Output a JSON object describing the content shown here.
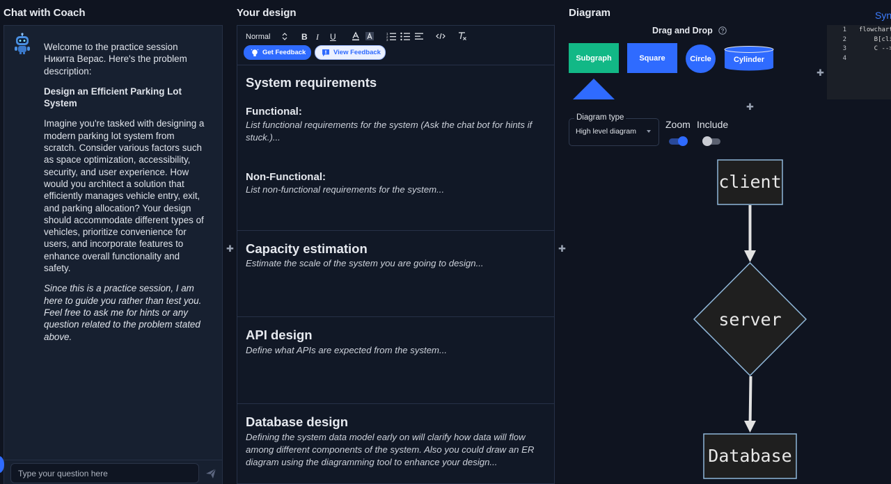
{
  "sections": {
    "chat_title": "Chat with Coach",
    "design_title": "Your design",
    "diagram_title": "Diagram"
  },
  "chat": {
    "intro": "Welcome to the practice session Никита Верас. Here's the problem description:",
    "problem_title": "Design an Efficient Parking Lot System",
    "problem_body": "Imagine you're tasked with designing a modern parking lot system from scratch. Consider various factors such as space optimization, accessibility, security, and user experience. How would you architect a solution that efficiently manages vehicle entry, exit, and parking allocation? Your design should accommodate different types of vehicles, prioritize convenience for users, and incorporate features to enhance overall functionality and safety.",
    "note": "Since this is a practice session, I am here to guide you rather than test you. Feel free to ask me for hints or any question related to the problem stated above.",
    "input_placeholder": "Type your question here"
  },
  "toolbar": {
    "format_value": "Normal",
    "get_feedback": "Get Feedback",
    "view_feedback": "View Feedback"
  },
  "design": {
    "system_req": {
      "heading": "System requirements",
      "functional_label": "Functional:",
      "functional_text": "List functional requirements for the system (Ask the chat bot for hints if stuck.)...",
      "nonfunctional_label": "Non-Functional:",
      "nonfunctional_text": "List non-functional requirements for the system..."
    },
    "capacity": {
      "heading": "Capacity estimation",
      "text": "Estimate the scale of the system you are going to design..."
    },
    "api": {
      "heading": "API design",
      "text": "Define what APIs are expected from the system..."
    },
    "database": {
      "heading": "Database design",
      "text": "Defining the system data model early on will clarify how data will flow among different components of the system. Also you could draw an ER diagram using the diagramming tool to enhance your design..."
    }
  },
  "diagram": {
    "palette_title": "Drag and Drop",
    "shapes": {
      "subgraph": "Subgraph",
      "square": "Square",
      "circle": "Circle",
      "cylinder": "Cylinder"
    },
    "type_label": "Diagram type",
    "type_value": "High level diagram",
    "zoom_label": "Zoom",
    "zoom_on": true,
    "include_label": "Include",
    "include_on": false,
    "nodes": {
      "client": "client",
      "server": "server",
      "database": "Database"
    }
  },
  "code": {
    "sync_label": "Sync",
    "lines": [
      {
        "n": "1",
        "text": "flowchart TD"
      },
      {
        "n": "2",
        "text": "    B[client] --> C{server}"
      },
      {
        "n": "3",
        "text": "    C --> D[Database]"
      },
      {
        "n": "4",
        "text": ""
      }
    ]
  },
  "colors": {
    "accent": "#2f6bff",
    "subgraph": "#12b886",
    "background": "#0f1420"
  }
}
